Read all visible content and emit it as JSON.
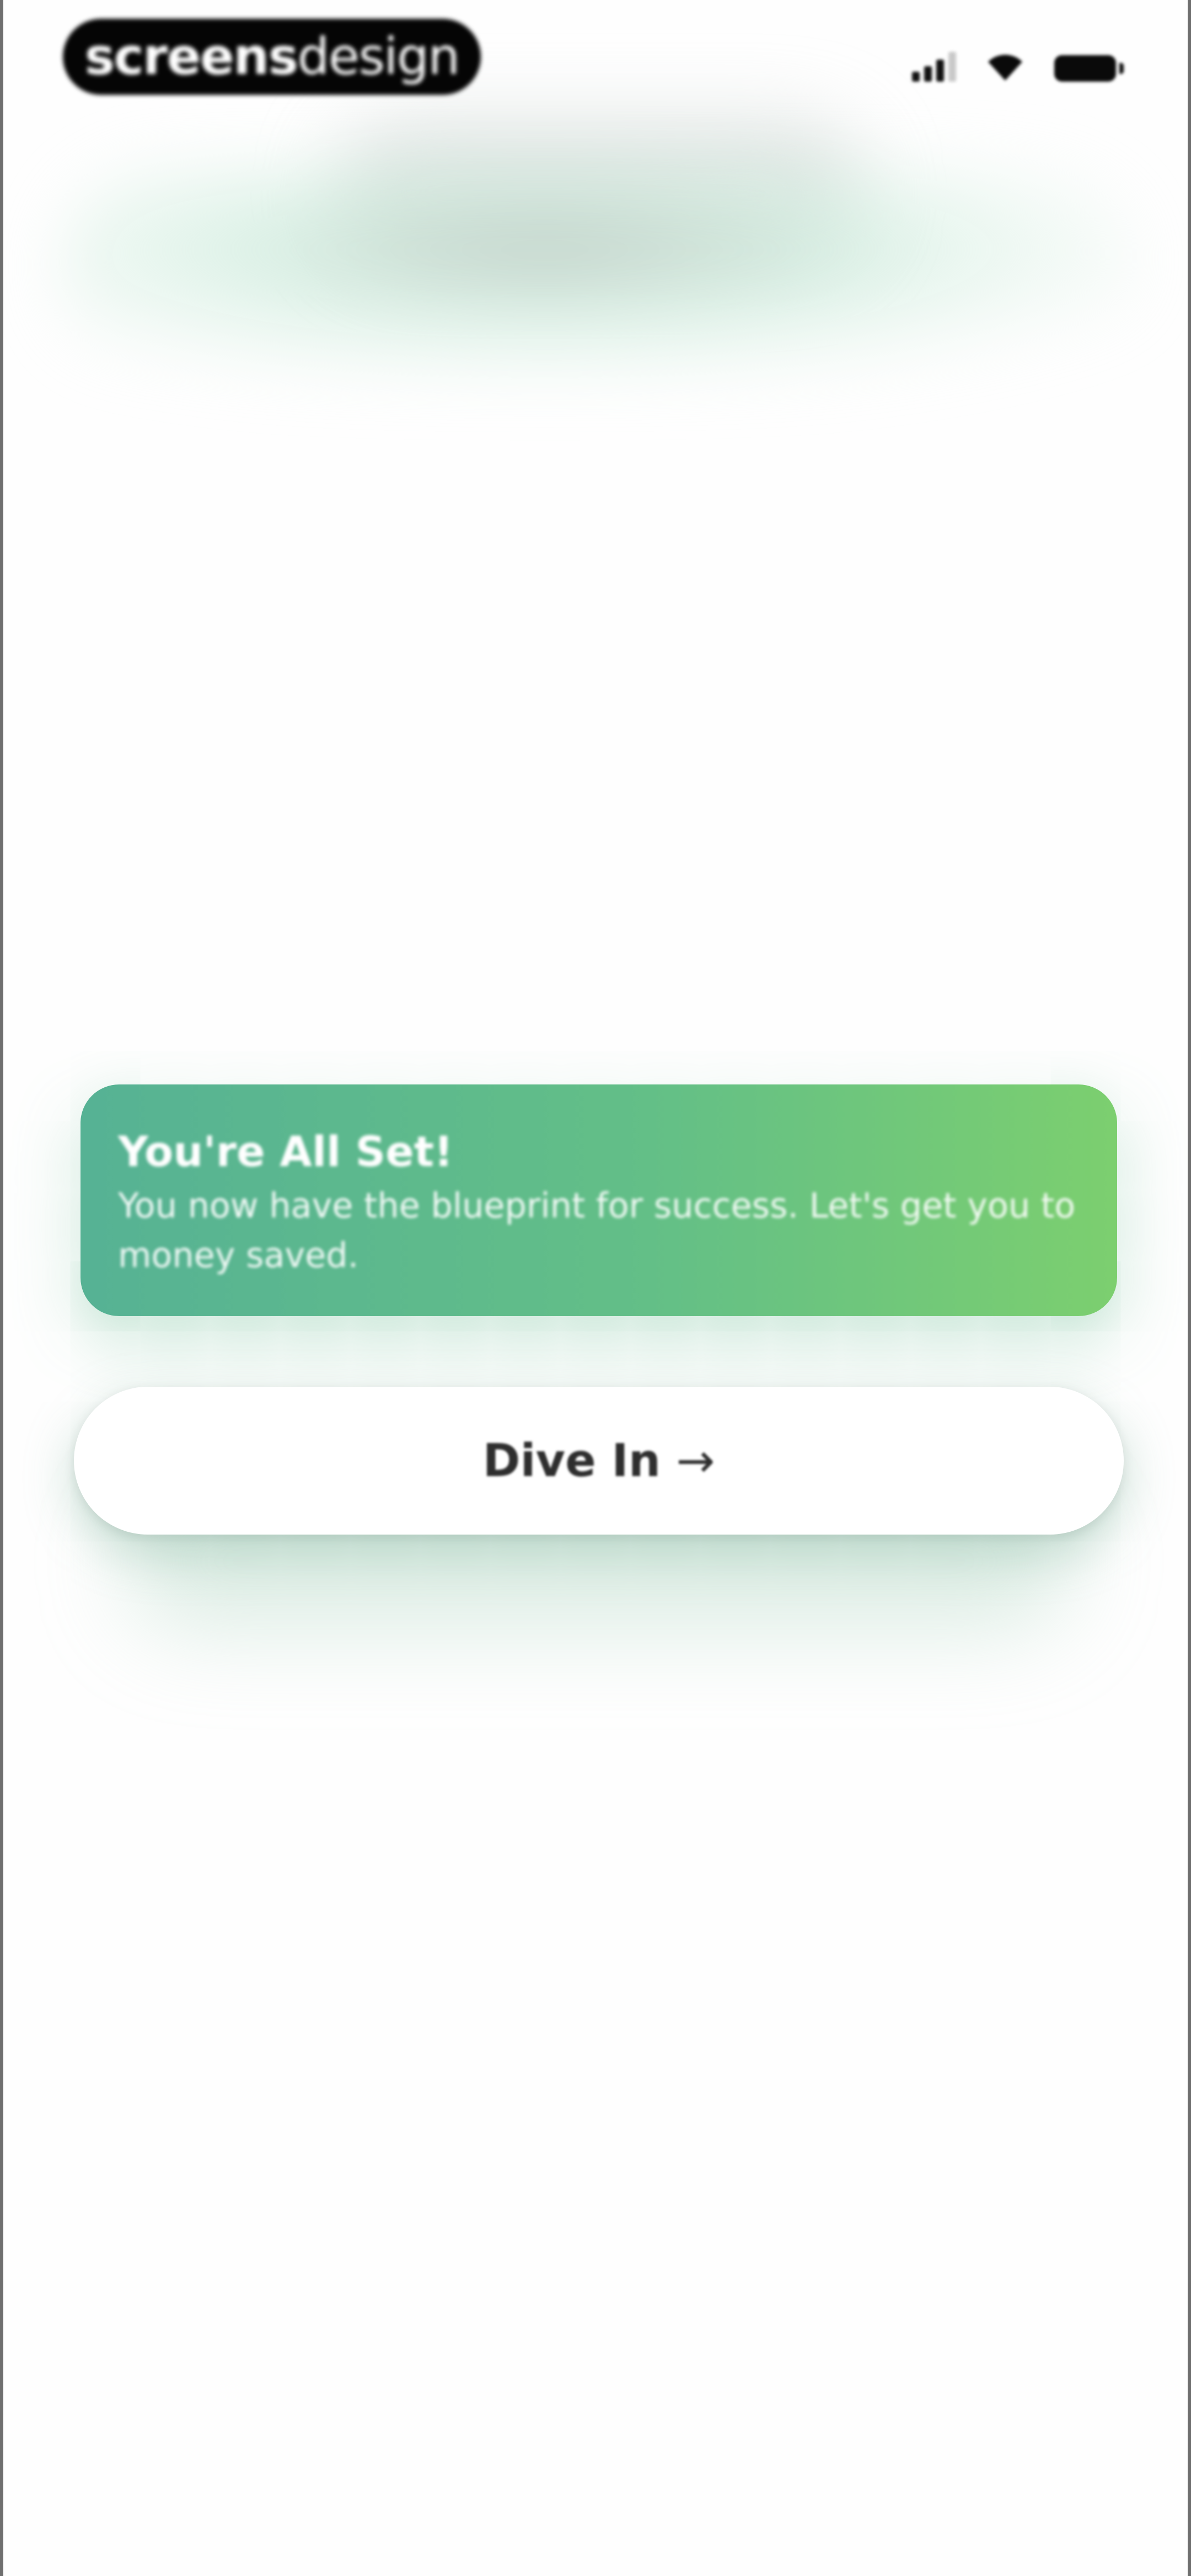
{
  "watermark": {
    "part_bold": "screens",
    "part_light": "design"
  },
  "status_bar": {
    "icons": [
      "signal-icon",
      "wifi-icon",
      "battery-icon"
    ]
  },
  "card": {
    "title": "You're All Set!",
    "body": "You now have the blueprint for success. Let's get you to money saved.",
    "gradient_start": "#56b294",
    "gradient_end": "#7ccf6f"
  },
  "action": {
    "label": "Dive In",
    "arrow": "→"
  },
  "colors": {
    "background": "#fefefe",
    "text_dark": "#2e2e2e",
    "accent_green": "#63bf87"
  }
}
